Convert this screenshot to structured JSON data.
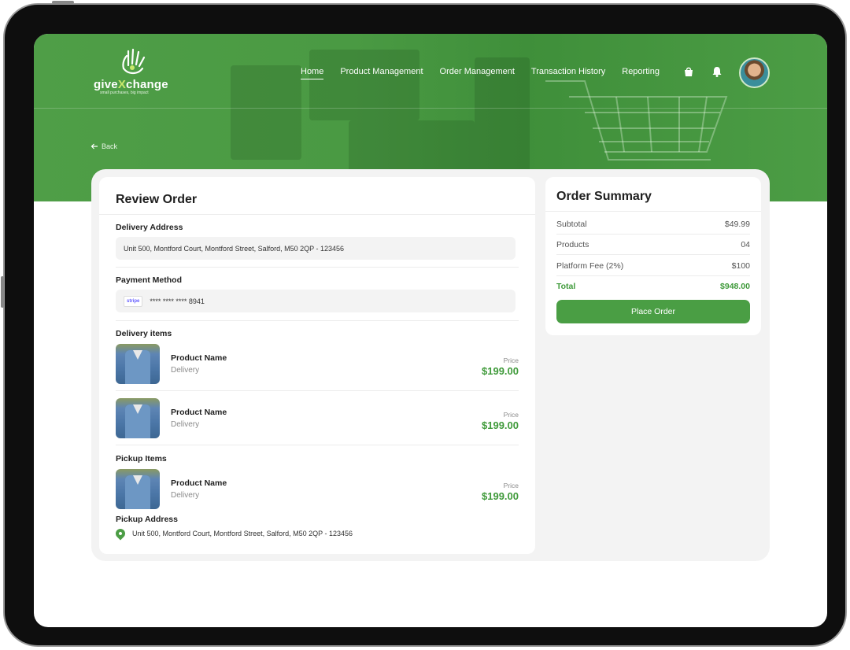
{
  "app": {
    "logo_prefix": "give",
    "logo_x": "X",
    "logo_suffix": "change",
    "logo_tagline": "small purchases, big impact"
  },
  "nav": {
    "items": [
      {
        "label": "Home",
        "active": true
      },
      {
        "label": "Product Management"
      },
      {
        "label": "Order Management"
      },
      {
        "label": "Transaction History"
      },
      {
        "label": "Reporting"
      }
    ],
    "icons": [
      "bag-icon",
      "bell-icon"
    ]
  },
  "back_label": "Back",
  "review": {
    "title": "Review Order",
    "delivery_address_label": "Delivery Address",
    "delivery_address": "Unit 500, Montford Court, Montford Street, Salford, M50 2QP - 123456",
    "payment_method_label": "Payment Method",
    "payment_brand": "stripe",
    "payment_card": "**** **** **** 8941",
    "delivery_items_label": "Delivery items",
    "delivery_items": [
      {
        "name": "Product Name",
        "sub": "Delivery",
        "price_label": "Price",
        "price": "$199.00"
      },
      {
        "name": "Product Name",
        "sub": "Delivery",
        "price_label": "Price",
        "price": "$199.00"
      }
    ],
    "pickup_items_label": "Pickup Items",
    "pickup_items": [
      {
        "name": "Product Name",
        "sub": "Delivery",
        "price_label": "Price",
        "price": "$199.00"
      }
    ],
    "pickup_address_label": "Pickup Address",
    "pickup_address": "Unit 500, Montford Court, Montford Street, Salford, M50 2QP - 123456"
  },
  "summary": {
    "title": "Order Summary",
    "rows": [
      {
        "label": "Subtotal",
        "value": "$49.99"
      },
      {
        "label": "Products",
        "value": "04"
      },
      {
        "label": "Platform Fee (2%)",
        "value": "$100"
      },
      {
        "label": "Total",
        "value": "$948.00"
      }
    ],
    "place_order": "Place Order"
  },
  "colors": {
    "brand_green": "#4a9e44",
    "price_green": "#3f9a3a"
  }
}
